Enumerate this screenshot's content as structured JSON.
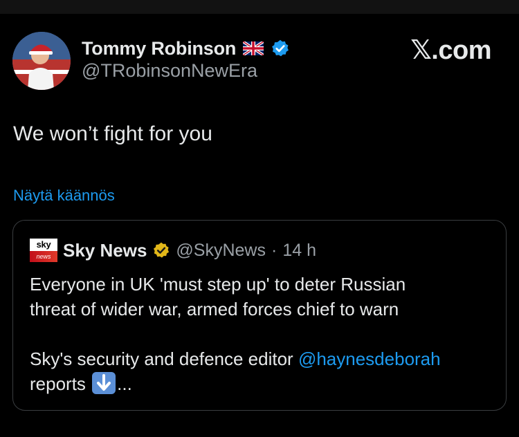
{
  "author": {
    "display_name": "Tommy Robinson",
    "handle": "@TRobinsonNewEra",
    "flag_icon": "uk-flag-icon",
    "verified_icon": "verified-blue-check-icon",
    "verified_color": "#1d9bf0"
  },
  "brand": {
    "label": "𝕏.com"
  },
  "tweet": {
    "text": "We won’t fight for you",
    "translate_link": "Näytä käännös"
  },
  "quote": {
    "logo_top": "sky",
    "logo_bottom": "news",
    "name": "Sky News",
    "verified_icon": "verified-gold-check-icon",
    "verified_color": "#e2b719",
    "handle": "@SkyNews",
    "separator": "·",
    "time": "14 h",
    "line1": "Everyone in UK 'must step up' to deter Russian",
    "line2": "threat of wider war, armed forces chief to warn",
    "line3_prefix": "Sky's security and defence editor ",
    "mention": "@haynesdeborah",
    "line4_prefix": "reports ",
    "emoji_icon": "down-arrow-emoji-icon",
    "line4_suffix": "..."
  },
  "colors": {
    "background": "#000000",
    "text": "#e7e9ea",
    "secondary": "#9aa0a6",
    "link": "#1d9bf0",
    "border": "#3a3d40"
  }
}
